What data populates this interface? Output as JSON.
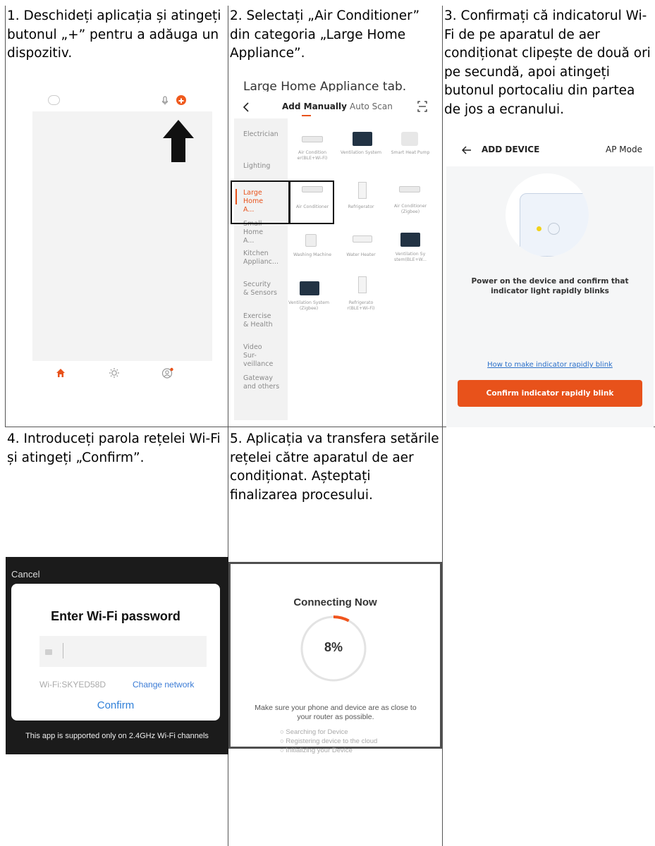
{
  "cells": {
    "c1": {
      "text": "1. Deschideți aplicația și atingeți butonul „+” pentru a adăuga un dispozitiv.",
      "screen": {
        "bottom_nav": [
          "home-icon",
          "sun-icon",
          "profile-icon"
        ],
        "indicator_icons": [
          "lens-icon",
          "mic-icon",
          "plus-icon",
          "arrow-up-icon"
        ]
      }
    },
    "c2": {
      "text": "2. Selectați „Air Conditioner” din categoria „Large Home Appliance”.",
      "screen": {
        "caption": "Large Home Appliance tab.",
        "tab_manual": "Add Manually",
        "tab_scan": "Auto Scan",
        "categories": [
          "Electrician",
          "Lighting",
          "Large Home A...",
          "Small Home A...",
          "Kitchen Applianc...",
          "Security & Sensors",
          "Exercise & Health",
          "Video Sur-veillance",
          "Gateway and others"
        ],
        "devices": [
          "Air Condition er(BLE+Wi-Fi)",
          "Ventilation System",
          "Smart Heat Pump",
          "Air Conditioner",
          "Refrigerator",
          "Air Conditioner (Zigbee)",
          "Washing Machine",
          "Water Heater",
          "Ventilation Sy stem(BLE+W...",
          "Ventilation System (Zigbee)",
          "Refrigerato r(BLE+Wi-Fi)"
        ]
      }
    },
    "c3": {
      "text": "3. Confirmați că indicatorul Wi-Fi de pe aparatul de aer condiționat clipește de două ori pe secundă, apoi atingeți butonul portocaliu din partea de jos a ecranului.",
      "screen": {
        "title": "ADD DEVICE",
        "mode": "AP Mode",
        "instruction": "Power on the device and confirm that indicator light rapidly blinks",
        "help_link": "How to make indicator rapidly blink",
        "confirm": "Confirm indicator rapidly blink",
        "accent_color": "#e8521b"
      }
    },
    "c4": {
      "text": "4. Introduceți parola rețelei Wi-Fi și atingeți „Confirm”.",
      "screen": {
        "cancel": "Cancel",
        "title": "Enter Wi-Fi password",
        "password_value": "",
        "wifi": "Wi-Fi:SKYED58D",
        "change": "Change network",
        "confirm": "Confirm",
        "footer": "This app is supported only on 2.4GHz Wi-Fi channels"
      }
    },
    "c5": {
      "text": "5. Aplicația va transfera setările rețelei către aparatul de aer condiționat. Așteptați finalizarea procesului.",
      "screen": {
        "title": "Connecting Now",
        "progress": "8%",
        "progress_fraction": 0.08,
        "message": "Make sure your phone and device are as close to your router as possible.",
        "steps": [
          "Searching for Device",
          "Registering device to the cloud",
          "Initializing your Device"
        ]
      }
    }
  }
}
